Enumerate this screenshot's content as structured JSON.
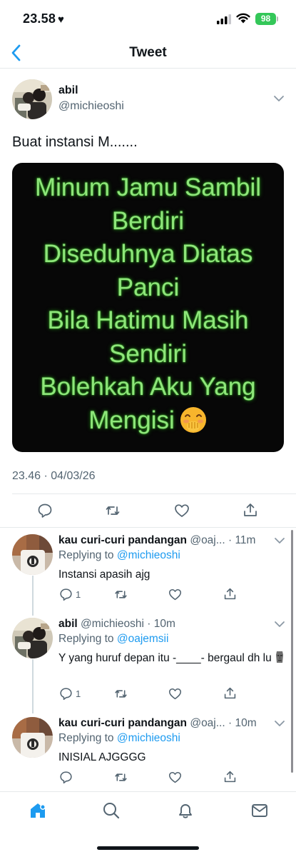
{
  "status_bar": {
    "time": "23.58",
    "battery": "98"
  },
  "nav": {
    "title": "Tweet"
  },
  "tweet": {
    "author_name": "abil",
    "author_handle": "@michieoshi",
    "text": "Buat instansi M.......",
    "media_lines": [
      "Minum Jamu Sambil",
      "Berdiri",
      "Diseduhnya Diatas",
      "Panci",
      "Bila Hatimu Masih",
      "Sendiri",
      "Bolehkah Aku Yang",
      "Mengisi"
    ],
    "timestamp": "23.46 · 04/03/26"
  },
  "replies": [
    {
      "name": "kau curi-curi pandangan",
      "handle": "@oaj...",
      "time": "· 11m",
      "replying_label": "Replying to",
      "replying_to": "@michieoshi",
      "text": "Instansi apasih ajg",
      "reply_count": "1"
    },
    {
      "name": "abil",
      "handle": "@michieoshi",
      "time": "· 10m",
      "replying_label": "Replying to",
      "replying_to": "@oajemsii",
      "text": "Y yang huruf depan itu -____- bergaul dh lu",
      "reply_count": "1"
    },
    {
      "name": "kau curi-curi pandangan",
      "handle": "@oaj...",
      "time": "· 10m",
      "replying_label": "Replying to",
      "replying_to": "@michieoshi",
      "text": "INISIAL AJGGGG",
      "reply_count": ""
    }
  ],
  "colors": {
    "accent": "#1d9bf0",
    "text": "#0f1419",
    "muted": "#536471",
    "media_text": "#8ee67a",
    "battery": "#34c759"
  },
  "icons": [
    "back-chevron-icon",
    "more-chevron-icon",
    "reply-icon",
    "retweet-icon",
    "like-icon",
    "share-icon",
    "home-icon",
    "search-icon",
    "notifications-icon",
    "messages-icon"
  ]
}
